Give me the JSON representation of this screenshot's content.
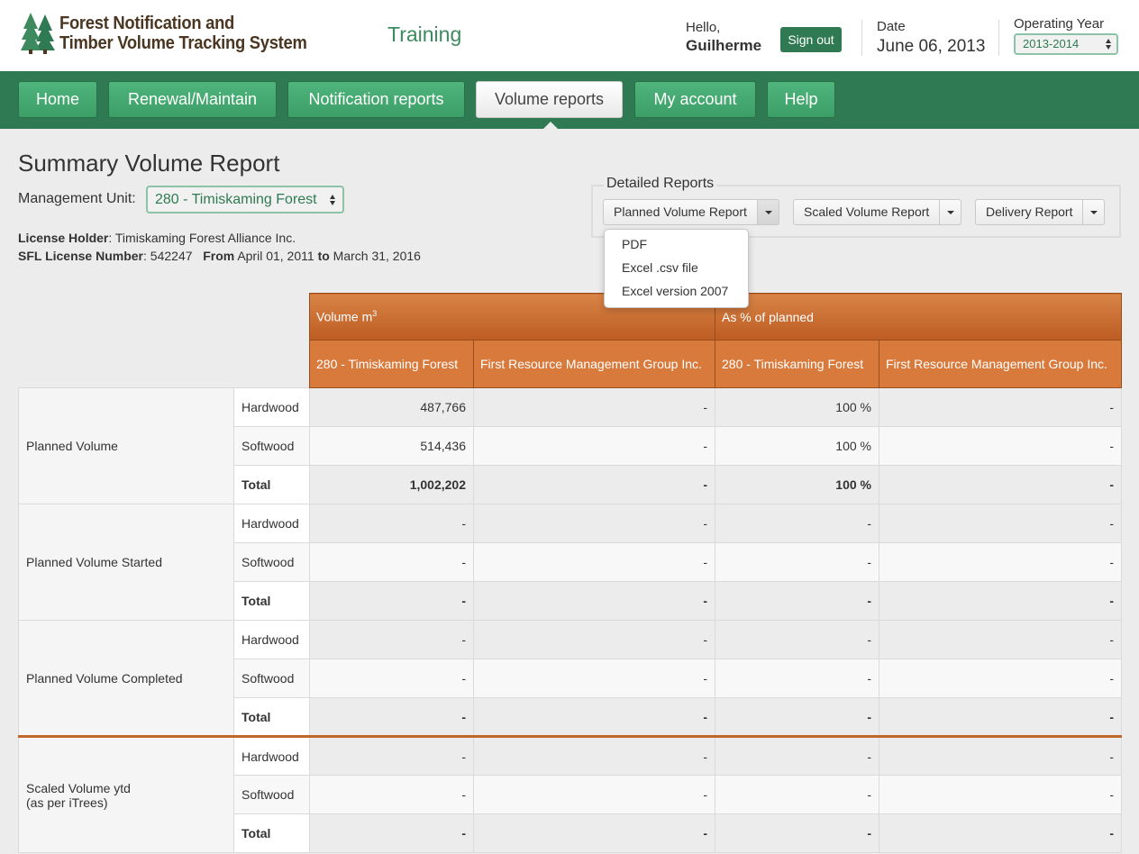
{
  "header": {
    "title_line1": "Forest Notification and",
    "title_line2": "Timber Volume Tracking System",
    "environment": "Training",
    "greeting": "Hello,",
    "user": "Guilherme",
    "signout_label": "Sign out",
    "date_label": "Date",
    "date_value": "June 06, 2013",
    "operating_year_label": "Operating Year",
    "operating_year_value": "2013-2014"
  },
  "nav": {
    "items": [
      {
        "label": "Home"
      },
      {
        "label": "Renewal/Maintain"
      },
      {
        "label": "Notification reports"
      },
      {
        "label": "Volume reports"
      },
      {
        "label": "My account"
      },
      {
        "label": "Help"
      }
    ],
    "active": "Volume reports"
  },
  "page": {
    "title": "Summary Volume Report",
    "mu_label": "Management Unit:",
    "mu_value": "280 - Timiskaming Forest",
    "license_holder_label": "License Holder",
    "license_holder": ": Timiskaming Forest Alliance Inc.",
    "sfl_label": "SFL License Number",
    "sfl_number": ": 542247",
    "from_label": "From",
    "from_date": "April 01, 2011",
    "to_label": "to",
    "to_date": "March 31, 2016"
  },
  "detailed_reports": {
    "legend": "Detailed Reports",
    "buttons": [
      {
        "label": "Planned Volume Report"
      },
      {
        "label": "Scaled Volume Report"
      },
      {
        "label": "Delivery Report"
      }
    ],
    "menu": [
      {
        "label": "PDF"
      },
      {
        "label": "Excel .csv file"
      },
      {
        "label": "Excel version 2007"
      }
    ]
  },
  "table": {
    "group_headers": {
      "volume": "Volume m",
      "volume_sup": "3",
      "percent": "As % of planned"
    },
    "columns": [
      "280 - Timiskaming Forest",
      "First Resource Management Group Inc.",
      "280 - Timiskaming Forest",
      "First Resource Management Group Inc."
    ],
    "groups": [
      {
        "label": "Planned Volume",
        "rows": [
          {
            "type": "Hardwood",
            "values": [
              "487,766",
              "-",
              "100 %",
              "-"
            ]
          },
          {
            "type": "Softwood",
            "values": [
              "514,436",
              "-",
              "100 %",
              "-"
            ]
          },
          {
            "type": "Total",
            "values": [
              "1,002,202",
              "-",
              "100 %",
              "-"
            ]
          }
        ]
      },
      {
        "label": "Planned Volume Started",
        "rows": [
          {
            "type": "Hardwood",
            "values": [
              "-",
              "-",
              "-",
              "-"
            ]
          },
          {
            "type": "Softwood",
            "values": [
              "-",
              "-",
              "-",
              "-"
            ]
          },
          {
            "type": "Total",
            "values": [
              "-",
              "-",
              "-",
              "-"
            ]
          }
        ]
      },
      {
        "label": "Planned Volume Completed",
        "rows": [
          {
            "type": "Hardwood",
            "values": [
              "-",
              "-",
              "-",
              "-"
            ]
          },
          {
            "type": "Softwood",
            "values": [
              "-",
              "-",
              "-",
              "-"
            ]
          },
          {
            "type": "Total",
            "values": [
              "-",
              "-",
              "-",
              "-"
            ]
          }
        ]
      },
      {
        "label": "Scaled Volume ytd",
        "sublabel": "(as per iTrees)",
        "rows": [
          {
            "type": "Hardwood",
            "values": [
              "-",
              "-",
              "-",
              "-"
            ]
          },
          {
            "type": "Softwood",
            "values": [
              "-",
              "-",
              "-",
              "-"
            ]
          },
          {
            "type": "Total",
            "values": [
              "-",
              "-",
              "-",
              "-"
            ]
          }
        ]
      }
    ]
  },
  "colors": {
    "brand_green": "#2f7a52",
    "nav_button": "#3b9e66",
    "logo_brown": "#4a3621",
    "table_header": "#d87a3c",
    "group_separator": "#c0662a"
  }
}
